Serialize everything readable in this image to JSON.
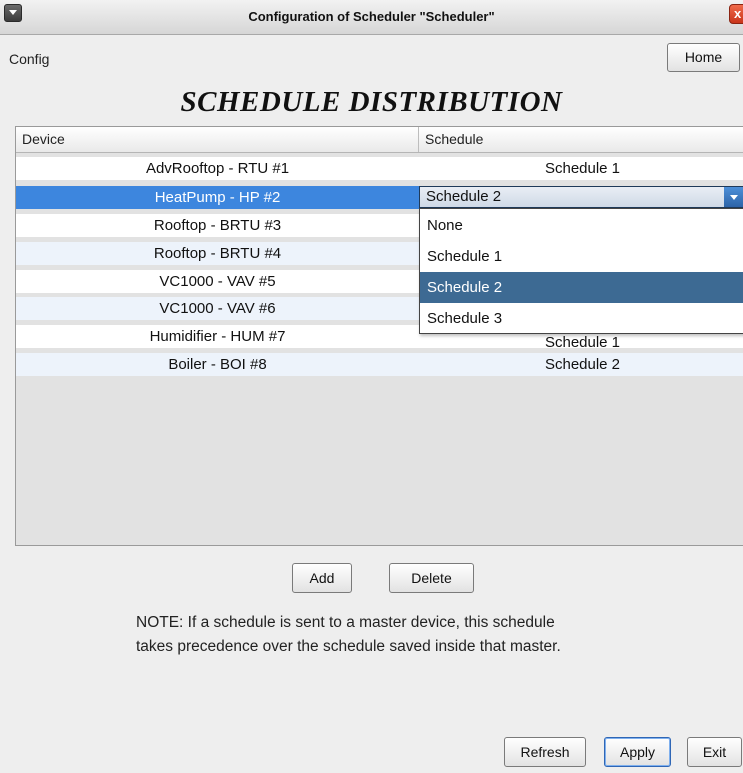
{
  "window": {
    "title": "Configuration of Scheduler \"Scheduler\"",
    "close_glyph": "x"
  },
  "menu": {
    "config_label": "Config",
    "home_label": "Home"
  },
  "heading": "SCHEDULE DISTRIBUTION",
  "table": {
    "columns": [
      "Device",
      "Schedule"
    ],
    "rows": [
      {
        "device": "AdvRooftop - RTU #1",
        "schedule": "Schedule 1"
      },
      {
        "device": "HeatPump - HP #2",
        "schedule": "Schedule 2"
      },
      {
        "device": "Rooftop - BRTU #3",
        "schedule": ""
      },
      {
        "device": "Rooftop - BRTU #4",
        "schedule": ""
      },
      {
        "device": "VC1000 - VAV #5",
        "schedule": ""
      },
      {
        "device": "VC1000 - VAV #6",
        "schedule": ""
      },
      {
        "device": "Humidifier - HUM #7",
        "schedule": "Schedule 1"
      },
      {
        "device": "Boiler - BOI #8",
        "schedule": "Schedule 2"
      }
    ],
    "selected_row_index": 1
  },
  "dropdown": {
    "value": "Schedule 2",
    "options": [
      "None",
      "Schedule 1",
      "Schedule 2",
      "Schedule 3"
    ],
    "highlighted_index": 2
  },
  "buttons": {
    "add": "Add",
    "delete": "Delete",
    "refresh": "Refresh",
    "apply": "Apply",
    "exit": "Exit"
  },
  "note": {
    "line1": "NOTE: If a schedule is sent to a master device, this schedule",
    "line2": "takes precedence over the schedule saved inside that master."
  },
  "colors": {
    "selection": "#3d86de",
    "dropdown_highlight": "#3d6a93",
    "row_alt": "#edf3fb"
  }
}
